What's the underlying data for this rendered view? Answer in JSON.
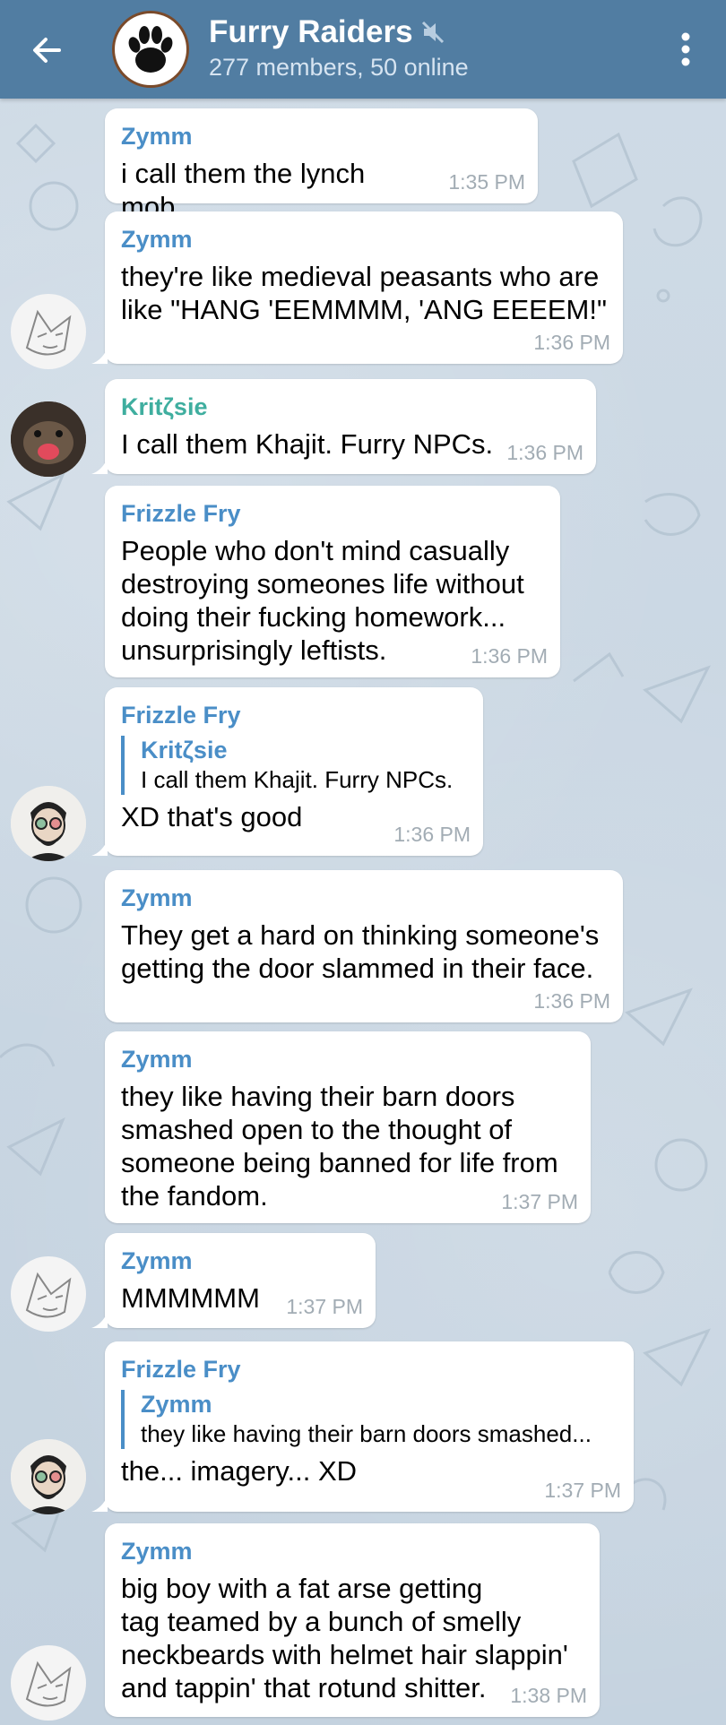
{
  "header": {
    "group_name": "Furry Raiders",
    "members": "277 members, 50 online",
    "bar_color": "#517da2",
    "icons": {
      "back": "back-arrow-icon",
      "mute": "muted-speaker-icon",
      "menu": "more-vertical-icon"
    }
  },
  "colors": {
    "zymm": "#4a8ec7",
    "kritzsie": "#3fae9f",
    "frizzle": "#4a8ec7",
    "timestamp": "#a2acb4"
  },
  "messages": [
    {
      "sender": "Zymm",
      "text": "i call them the lynch mob",
      "time": "1:35 PM"
    },
    {
      "sender": "Zymm",
      "text": "they're like medieval peasants who are\nlike \"HANG 'EEMMMM, 'ANG EEEEM!\"",
      "time": "1:36 PM"
    },
    {
      "sender": "Kritζsie",
      "text": "I call them Khajit. Furry NPCs.",
      "time": "1:36 PM"
    },
    {
      "sender": "Frizzle Fry",
      "text": "People who don't mind casually\ndestroying someones life without\ndoing their fucking homework...\nunsurprisingly leftists.",
      "time": "1:36 PM"
    },
    {
      "sender": "Frizzle Fry",
      "reply_name": "Kritζsie",
      "reply_text": "I call them Khajit. Furry NPCs.",
      "text": "XD that's good",
      "time": "1:36 PM"
    },
    {
      "sender": "Zymm",
      "text": "They get a hard on thinking someone's\ngetting the door slammed in their face.",
      "time": "1:36 PM"
    },
    {
      "sender": "Zymm",
      "text": "they like having their barn doors\nsmashed open to the thought of\nsomeone being banned for life from\nthe fandom.",
      "time": "1:37 PM"
    },
    {
      "sender": "Zymm",
      "text": "MMMMMM",
      "time": "1:37 PM"
    },
    {
      "sender": "Frizzle Fry",
      "reply_name": "Zymm",
      "reply_text": "they like having their barn doors smashed...",
      "text": "the... imagery... XD",
      "time": "1:37 PM"
    },
    {
      "sender": "Zymm",
      "text": "big boy with a fat arse getting\ntag teamed by a bunch of smelly\nneckbeards with helmet hair slappin'\nand tappin' that rotund shitter.",
      "time": "1:38 PM"
    }
  ]
}
